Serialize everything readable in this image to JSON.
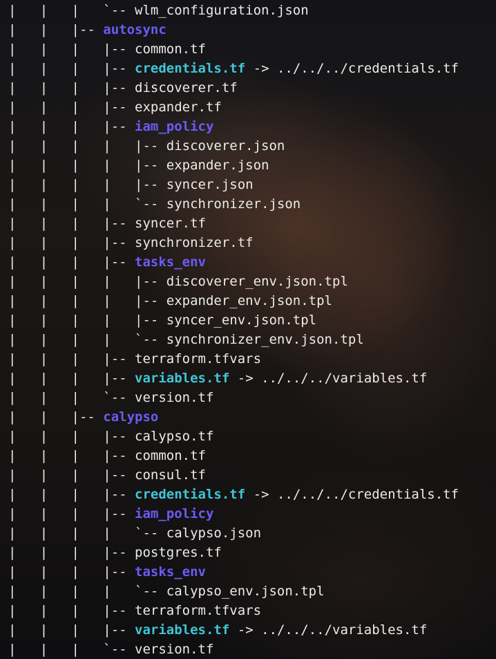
{
  "terminal": {
    "lines": [
      {
        "prefix": "|   |   |   `-- ",
        "name": "wlm_configuration.json",
        "kind": "file"
      },
      {
        "prefix": "|   |   |-- ",
        "name": "autosync",
        "kind": "dir"
      },
      {
        "prefix": "|   |   |   |-- ",
        "name": "common.tf",
        "kind": "file"
      },
      {
        "prefix": "|   |   |   |-- ",
        "name": "credentials.tf",
        "kind": "link",
        "arrow": " -> ",
        "target": "../../../credentials.tf"
      },
      {
        "prefix": "|   |   |   |-- ",
        "name": "discoverer.tf",
        "kind": "file"
      },
      {
        "prefix": "|   |   |   |-- ",
        "name": "expander.tf",
        "kind": "file"
      },
      {
        "prefix": "|   |   |   |-- ",
        "name": "iam_policy",
        "kind": "dir"
      },
      {
        "prefix": "|   |   |   |   |-- ",
        "name": "discoverer.json",
        "kind": "file"
      },
      {
        "prefix": "|   |   |   |   |-- ",
        "name": "expander.json",
        "kind": "file"
      },
      {
        "prefix": "|   |   |   |   |-- ",
        "name": "syncer.json",
        "kind": "file"
      },
      {
        "prefix": "|   |   |   |   `-- ",
        "name": "synchronizer.json",
        "kind": "file"
      },
      {
        "prefix": "|   |   |   |-- ",
        "name": "syncer.tf",
        "kind": "file"
      },
      {
        "prefix": "|   |   |   |-- ",
        "name": "synchronizer.tf",
        "kind": "file"
      },
      {
        "prefix": "|   |   |   |-- ",
        "name": "tasks_env",
        "kind": "dir"
      },
      {
        "prefix": "|   |   |   |   |-- ",
        "name": "discoverer_env.json.tpl",
        "kind": "file"
      },
      {
        "prefix": "|   |   |   |   |-- ",
        "name": "expander_env.json.tpl",
        "kind": "file"
      },
      {
        "prefix": "|   |   |   |   |-- ",
        "name": "syncer_env.json.tpl",
        "kind": "file"
      },
      {
        "prefix": "|   |   |   |   `-- ",
        "name": "synchronizer_env.json.tpl",
        "kind": "file"
      },
      {
        "prefix": "|   |   |   |-- ",
        "name": "terraform.tfvars",
        "kind": "file"
      },
      {
        "prefix": "|   |   |   |-- ",
        "name": "variables.tf",
        "kind": "link",
        "arrow": " -> ",
        "target": "../../../variables.tf"
      },
      {
        "prefix": "|   |   |   `-- ",
        "name": "version.tf",
        "kind": "file"
      },
      {
        "prefix": "|   |   |-- ",
        "name": "calypso",
        "kind": "dir"
      },
      {
        "prefix": "|   |   |   |-- ",
        "name": "calypso.tf",
        "kind": "file"
      },
      {
        "prefix": "|   |   |   |-- ",
        "name": "common.tf",
        "kind": "file"
      },
      {
        "prefix": "|   |   |   |-- ",
        "name": "consul.tf",
        "kind": "file"
      },
      {
        "prefix": "|   |   |   |-- ",
        "name": "credentials.tf",
        "kind": "link",
        "arrow": " -> ",
        "target": "../../../credentials.tf"
      },
      {
        "prefix": "|   |   |   |-- ",
        "name": "iam_policy",
        "kind": "dir"
      },
      {
        "prefix": "|   |   |   |   `-- ",
        "name": "calypso.json",
        "kind": "file"
      },
      {
        "prefix": "|   |   |   |-- ",
        "name": "postgres.tf",
        "kind": "file"
      },
      {
        "prefix": "|   |   |   |-- ",
        "name": "tasks_env",
        "kind": "dir"
      },
      {
        "prefix": "|   |   |   |   `-- ",
        "name": "calypso_env.json.tpl",
        "kind": "file"
      },
      {
        "prefix": "|   |   |   |-- ",
        "name": "terraform.tfvars",
        "kind": "file"
      },
      {
        "prefix": "|   |   |   |-- ",
        "name": "variables.tf",
        "kind": "link",
        "arrow": " -> ",
        "target": "../../../variables.tf"
      },
      {
        "prefix": "|   |   |   `-- ",
        "name": "version.tf",
        "kind": "file"
      }
    ]
  },
  "colors": {
    "text": "#ecece8",
    "directory": "#6b5cf6",
    "symlink": "#3fc6d6"
  }
}
